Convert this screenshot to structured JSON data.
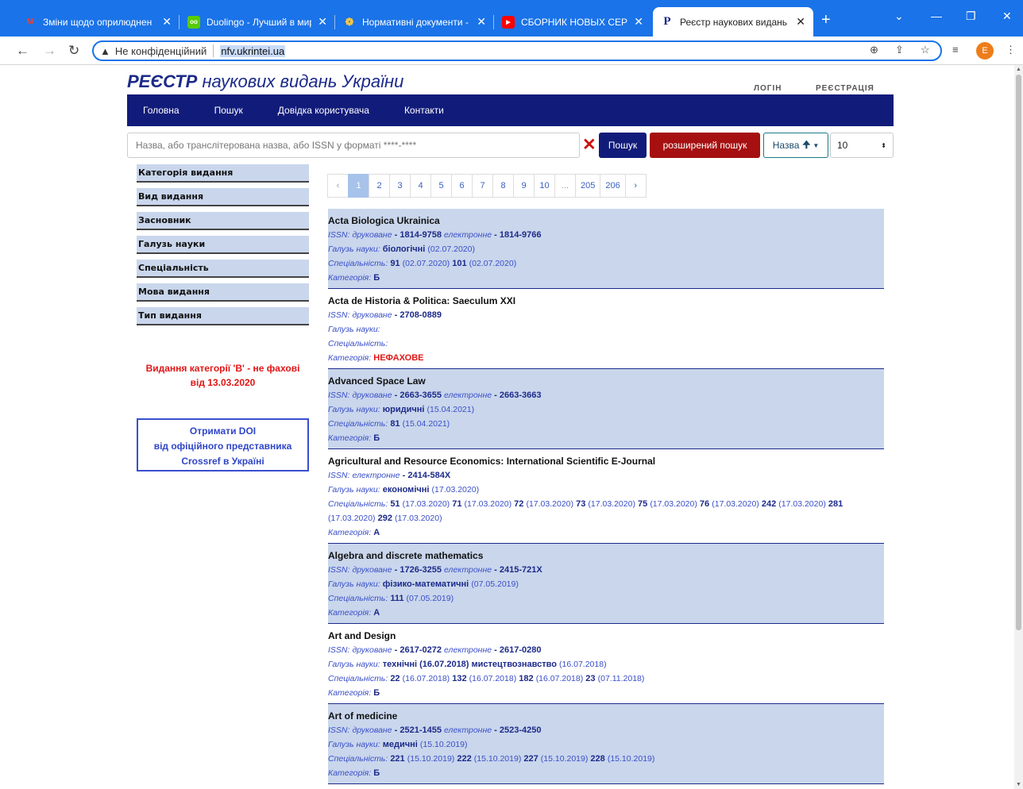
{
  "browser": {
    "tabs": [
      {
        "title": "Зміни щодо оприлюднен",
        "favicon": "M",
        "favicon_color": "#ea4335"
      },
      {
        "title": "Duolingo - Лучший в мир",
        "favicon": "oo",
        "favicon_color": "#58cc02"
      },
      {
        "title": "Нормативні документи -",
        "favicon": "❁",
        "favicon_color": "#f5c542"
      },
      {
        "title": "СБОРНИК НОВЫХ СЕРИ",
        "favicon": "▶",
        "favicon_color": "#ff0000"
      },
      {
        "title": "Реєстр наукових видань",
        "favicon": "P",
        "favicon_color": "#1c2a8a"
      }
    ],
    "new_tab": "+",
    "address": {
      "insecure_label": "Не конфіденційний",
      "url": "nfv.ukrintei.ua"
    },
    "profile_initial": "E"
  },
  "header": {
    "title_bold": "РЕЄСТР",
    "title_rest": "наукових видань України",
    "login": "ЛОГІН",
    "register": "РЕЄСТРАЦІЯ"
  },
  "nav": [
    "Головна",
    "Пошук",
    "Довідка користувача",
    "Контакти"
  ],
  "search": {
    "placeholder": "Назва, або транслітерована назва, або ISSN у форматі ****-****",
    "search_button": "Пошук",
    "advanced_button": "розширений пошук",
    "sort_label": "Назва",
    "per_page": "10"
  },
  "sidebar": {
    "items": [
      "Категорія видання",
      "Вид видання",
      "Засновник",
      "Галузь науки",
      "Спеціальність",
      "Мова видання",
      "Тип видання"
    ],
    "notice_line1": "Видання категорії 'В' - не фахові",
    "notice_line2": "від 13.03.2020",
    "doi_line1": "Отримати DOI",
    "doi_line2": "від офіційного представника",
    "doi_line3": "Crossref в Україні"
  },
  "pagination": [
    "‹",
    "1",
    "2",
    "3",
    "4",
    "5",
    "6",
    "7",
    "8",
    "9",
    "10",
    "...",
    "205",
    "206",
    "›"
  ],
  "labels": {
    "issn": "ISSN:",
    "print": "друковане",
    "electronic": "електронне",
    "field": "Галузь науки:",
    "specialty": "Спеціальність:",
    "category": "Категорія:"
  },
  "results": [
    {
      "name": "Acta Biologica Ukrainica",
      "issn_print": "1814-9758",
      "issn_electronic": "1814-9766",
      "field": "біологічні",
      "field_date": "(02.07.2020)",
      "specialties": [
        {
          "code": "91",
          "date": "(02.07.2020)"
        },
        {
          "code": "101",
          "date": "(02.07.2020)"
        }
      ],
      "category": "Б",
      "shaded": true
    },
    {
      "name": "Acta de Historia & Politica: Saeculum XXI",
      "issn_print": "2708-0889",
      "issn_electronic": "",
      "field": "",
      "field_date": "",
      "specialties": [],
      "category": "НЕФАХОВЕ",
      "category_red": true,
      "shaded": false
    },
    {
      "name": "Advanced Space Law",
      "issn_print": "2663-3655",
      "issn_electronic": "2663-3663",
      "field": "юридичні",
      "field_date": "(15.04.2021)",
      "specialties": [
        {
          "code": "81",
          "date": "(15.04.2021)"
        }
      ],
      "category": "Б",
      "shaded": true
    },
    {
      "name": "Agricultural and Resource Economics: International Scientific E-Journal",
      "issn_print": "",
      "issn_electronic": "2414-584X",
      "field": "економічні",
      "field_date": "(17.03.2020)",
      "specialties": [
        {
          "code": "51",
          "date": "(17.03.2020)"
        },
        {
          "code": "71",
          "date": "(17.03.2020)"
        },
        {
          "code": "72",
          "date": "(17.03.2020)"
        },
        {
          "code": "73",
          "date": "(17.03.2020)"
        },
        {
          "code": "75",
          "date": "(17.03.2020)"
        },
        {
          "code": "76",
          "date": "(17.03.2020)"
        },
        {
          "code": "242",
          "date": "(17.03.2020)"
        },
        {
          "code": "281",
          "date": "(17.03.2020)"
        },
        {
          "code": "292",
          "date": "(17.03.2020)"
        }
      ],
      "category": "А",
      "shaded": false
    },
    {
      "name": "Algebra and discrete mathematics",
      "issn_print": "1726-3255",
      "issn_electronic": "2415-721X",
      "field": "фізико-математичні",
      "field_date": "(07.05.2019)",
      "specialties": [
        {
          "code": "111",
          "date": "(07.05.2019)"
        }
      ],
      "category": "А",
      "shaded": true
    },
    {
      "name": "Art and Design",
      "issn_print": "2617-0272",
      "issn_electronic": "2617-0280",
      "field": "технічні (16.07.2018) мистецтвознавство",
      "field_date": "(16.07.2018)",
      "specialties": [
        {
          "code": "22",
          "date": "(16.07.2018)"
        },
        {
          "code": "132",
          "date": "(16.07.2018)"
        },
        {
          "code": "182",
          "date": "(16.07.2018)"
        },
        {
          "code": "23",
          "date": "(07.11.2018)"
        }
      ],
      "category": "Б",
      "shaded": false
    },
    {
      "name": "Art of medicine",
      "issn_print": "2521-1455",
      "issn_electronic": "2523-4250",
      "field": "медичні",
      "field_date": "(15.10.2019)",
      "specialties": [
        {
          "code": "221",
          "date": "(15.10.2019)"
        },
        {
          "code": "222",
          "date": "(15.10.2019)"
        },
        {
          "code": "227",
          "date": "(15.10.2019)"
        },
        {
          "code": "228",
          "date": "(15.10.2019)"
        }
      ],
      "category": "Б",
      "shaded": true
    }
  ]
}
